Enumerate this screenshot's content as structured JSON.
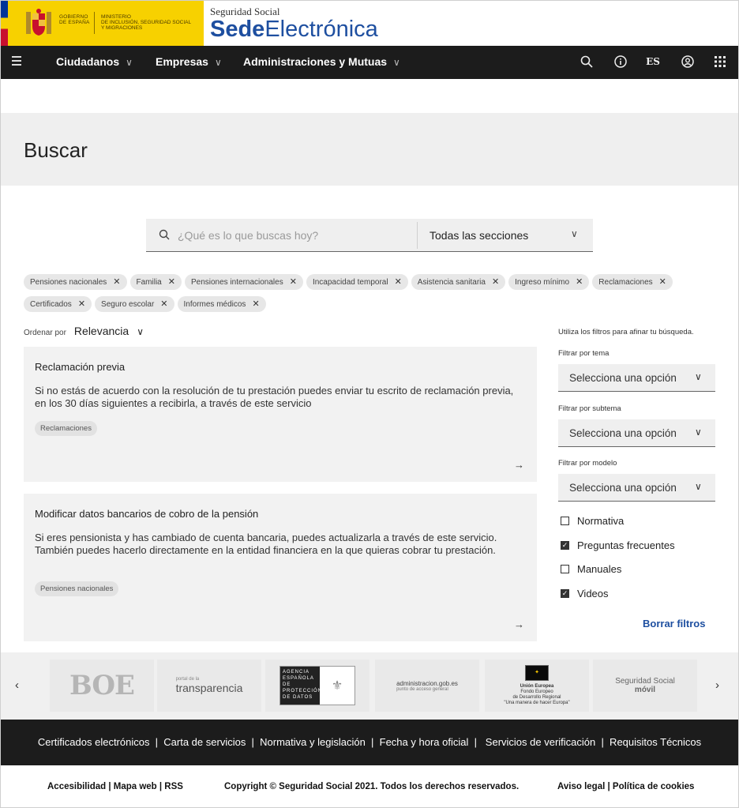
{
  "header": {
    "gov_line1": "GOBIERNO",
    "gov_line2": "DE ESPAÑA",
    "min_line1": "MINISTERIO",
    "min_line2": "DE INCLUSIÓN, SEGURIDAD SOCIAL",
    "min_line3": "Y MIGRACIONES",
    "sede_top": "Seguridad Social",
    "sede_bold": "Sede",
    "sede_light": "Electrónica"
  },
  "nav": {
    "items": [
      "Ciudadanos",
      "Empresas",
      "Administraciones y Mutuas"
    ],
    "lang": "ES"
  },
  "page": {
    "title": "Buscar"
  },
  "search": {
    "placeholder": "¿Qué es lo que buscas hoy?",
    "section": "Todas las secciones"
  },
  "chips": [
    "Pensiones nacionales",
    "Familia",
    "Pensiones internacionales",
    "Incapacidad temporal",
    "Asistencia sanitaria",
    "Ingreso mínimo",
    "Reclamaciones",
    "Certificados",
    "Seguro escolar",
    "Informes médicos"
  ],
  "sort": {
    "label": "Ordenar por",
    "value": "Relevancia"
  },
  "results": [
    {
      "title": "Reclamación previa",
      "desc": "Si no estás de acuerdo con la resolución de tu prestación puedes enviar tu escrito de reclamación previa, en los 30 días siguientes a recibirla, a través de este servicio",
      "tag": "Reclamaciones"
    },
    {
      "title": "Modificar datos bancarios de cobro de la pensión",
      "desc": "Si eres pensionista y has cambiado de cuenta bancaria, puedes actualizarla a través de este servicio. También puedes hacerlo directamente en la entidad financiera en la que quieras cobrar tu prestación.",
      "tag": "Pensiones nacionales"
    }
  ],
  "filters": {
    "hint": "Utiliza los filtros para afinar tu búsqueda.",
    "tema_label": "Filtrar por tema",
    "subtema_label": "Filtrar por subtema",
    "modelo_label": "Filtrar por modelo",
    "select_placeholder": "Selecciona una opción",
    "checks": [
      {
        "label": "Normativa",
        "checked": false
      },
      {
        "label": "Preguntas frecuentes",
        "checked": true
      },
      {
        "label": "Manuales",
        "checked": false
      },
      {
        "label": "Videos",
        "checked": true
      }
    ],
    "clear": "Borrar filtros"
  },
  "logos": {
    "boe": "BOE",
    "transparencia_small": "portal de la",
    "transparencia": "transparencia",
    "aepd": "AGENCIA ESPAÑOLA DE PROTECCIÓN DE DATOS",
    "administracion": "administracion.gob.es",
    "administracion_sub": "punto de acceso general",
    "ue_title": "Unión Europea",
    "ue_sub1": "Fondo Europeo",
    "ue_sub2": "de Desarrollo Regional",
    "ue_sub3": "\"Una manera de hacer Europa\"",
    "ssm_1": "Seguridad Social",
    "ssm_2": "móvil"
  },
  "footer": {
    "links": "Certificados electrónicos  |  Carta de servicios  |  Normativa y legislación  |  Fecha y hora oficial  |   Servicios de verificación  |  Requisitos Técnicos",
    "left": "Accesibilidad | Mapa web | RSS",
    "center": "Copyright © Seguridad Social 2021. Todos los derechos reservados.",
    "right": "Aviso legal | Política de cookies"
  }
}
